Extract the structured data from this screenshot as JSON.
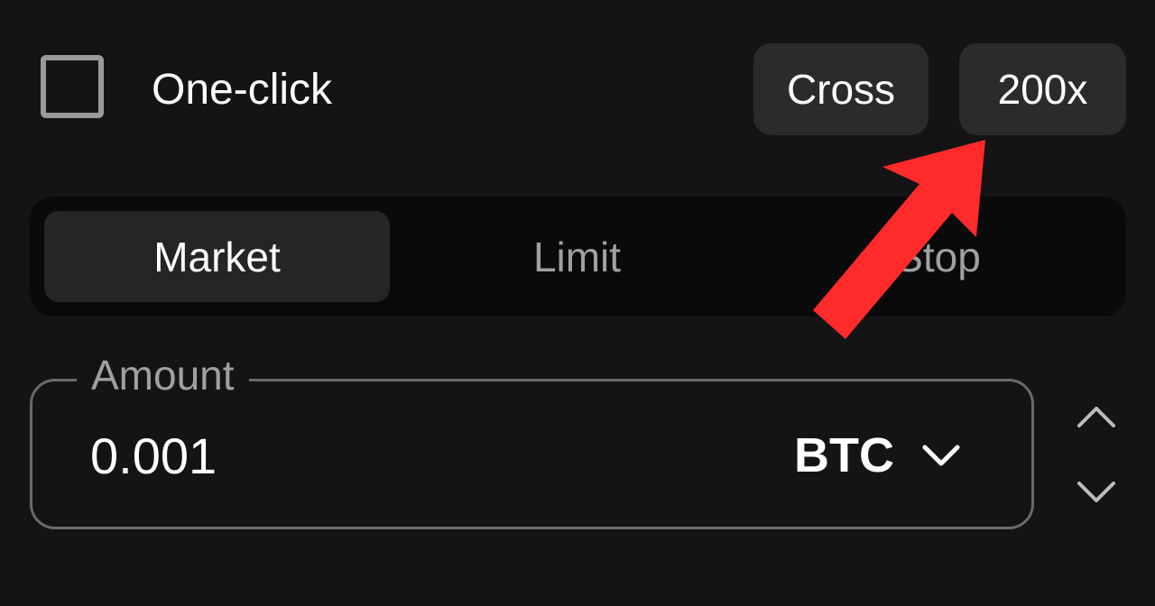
{
  "top_row": {
    "one_click_label": "One-click",
    "one_click_checked": false,
    "margin_mode_label": "Cross",
    "leverage_label": "200x"
  },
  "order_type_tabs": [
    {
      "label": "Market",
      "active": true
    },
    {
      "label": "Limit",
      "active": false
    },
    {
      "label": "Stop",
      "active": false
    }
  ],
  "amount": {
    "label": "Amount",
    "value": "0.001",
    "currency": "BTC"
  },
  "icons": {
    "currency_dropdown": "chevron-down-icon",
    "stepper_up": "chevron-up-icon",
    "stepper_down": "chevron-down-icon",
    "annotation": "red-arrow-annotation"
  },
  "colors": {
    "background": "#141414",
    "button_bg": "#2b2b2b",
    "segmented_bg": "#0a0a0a",
    "active_tab_bg": "#252525",
    "muted_text": "#a0a0a0",
    "annotation_red": "#ff2a2a"
  }
}
